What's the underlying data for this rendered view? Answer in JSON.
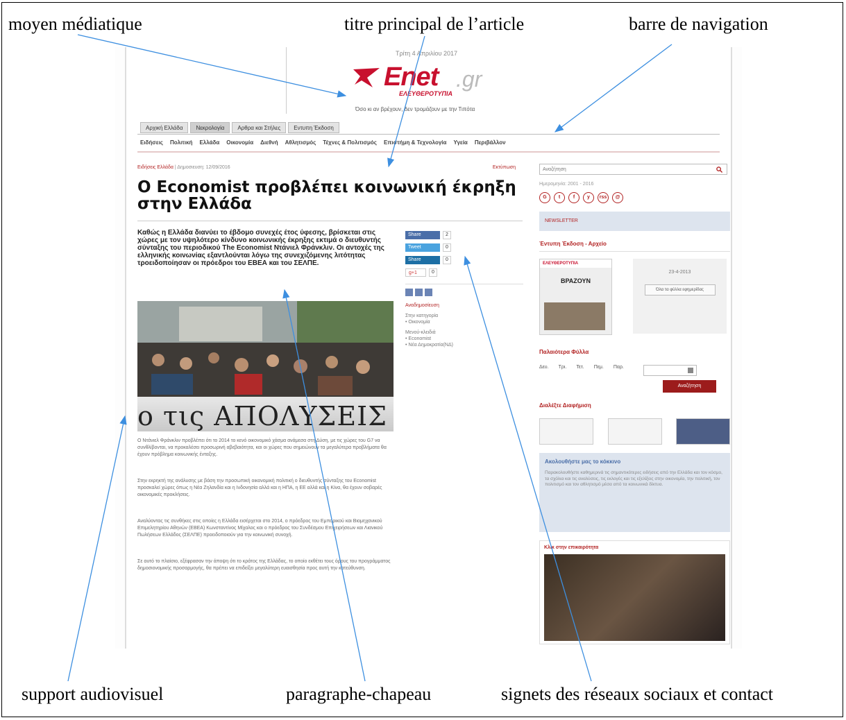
{
  "labels": {
    "media": "moyen médiatique",
    "main_title": "titre principal de l’article",
    "navbar": "barre de navigation",
    "audiovisual": "support audiovisuel",
    "lead": "paragraphe-chapeau",
    "social": "signets des réseaux sociaux et contact"
  },
  "site": {
    "date": "Τρίτη 4 Απριλίου 2017",
    "logo_text": "Enet",
    "logo_suffix": ".gr",
    "logo_sub": "ΕΛΕΥΘΕΡΟΤΥΠΙΑ",
    "slogan": "Όσο κι αν βρέχουν, δεν τρομάζουν με την Τιπότα"
  },
  "nav": {
    "tabs": [
      "Αρχική Ελλάδα",
      "Νεκρολογία",
      "Αρθρα και Στήλες",
      "Εντυπη Έκδοση"
    ],
    "items": [
      "Ειδήσεις",
      "Πολιτική",
      "Ελλάδα",
      "Οικονομία",
      "Διεθνή",
      "Αθλητισμός",
      "Τέχνες & Πολιτισμός",
      "Επιστήμη & Τεχνολογία",
      "Υγεία",
      "Περιβάλλον"
    ]
  },
  "article": {
    "category": "Ειδήσεις Ελλάδα",
    "timestamp": "Δημοσιευση: 12/09/2016",
    "share_label": "Εκτύπωση",
    "title": "Ο Economist προβλέπει κοινωνική έκρηξη στην Ελλάδα",
    "lede": "Καθώς η Ελλάδα διανύει το έβδομο συνεχές έτος ύφεσης, βρίσκεται στις χώρες με τον υψηλότερο κίνδυνο κοινωνικής έκρηξης εκτιμά ο διευθυντής σύνταξης του περιοδικού The Economist Ντάνιελ Φράνκλιν. Οι αντοχές της ελληνικής κοινωνίας εξαντλούνται λόγω της συνεχιζόμενης λιτότητας τροειδοποίησαν οι πρόεδροι του ΕΒΕΑ και του ΣΕΛΠΕ.",
    "photo_banner": "ο τις ΑΠΟΛΥΣΕΙΣ",
    "paragraphs": [
      "Ο Ντάνιελ Φράνκλιν προβλέπει ότι το 2014 το κενό οικονομικό χάσμα ανάμεσα στη Δύση, με τις χώρες του G7 να συνθλίβονται, να προκαλέσει προσωρινή αβεβαιότητα, και οι χώρες που σημειώνουν τα μεγαλύτερα προβλήματα θα έχουν πρόβλημα κοινωνικής ένταξης.",
      "Στην εκρηκτή της ανάλυσης με βάση την προσωπική οικονομική πολιτική ο διευθυντής σύνταξης του Economist προσκαλεί χώρες όπως η Νέα Ζηλανδία και η Ινδονησία αλλά και η ΗΠΑ, η ΕΕ αλλά και η Κίνα, θα έχουν σοβαρές οικονομικές προκλήσεις.",
      "Αναλύοντας τις συνθήκες στις οποίες η Ελλάδα εισέρχεται στο 2014, ο πρόεδρος του Εμπορικού και Βιομηχανικού Επιμελητηρίου Αθηνών (ΕΒΕΑ) Κωνσταντίνος Μίχαλος και ο πρόεδρος του Συνδέσμου Επιχειρήσεων και Λιανικού Πωλήσεων Ελλάδος (ΣΕΛΠΕ) προειδοποιούν για την κοινωνική συνοχή.",
      "Σε αυτό το πλαίσιο, εξέφρασαν την άποψη ότι το κράτος της Ελλάδας, το οποίο εκθέτει τους όρους του προγράμματος δημοσιονομικής προσαρμογής, θα πρέπει να επιδείξει μεγαλύτερη ευαισθησία προς αυτή την κατεύθυνση."
    ]
  },
  "social_col": {
    "buttons": [
      {
        "label": "Share",
        "count": "2"
      },
      {
        "label": "Tweet",
        "count": "0"
      },
      {
        "label": "Share",
        "count": "0"
      },
      {
        "label": "g+1",
        "count": "0"
      }
    ],
    "related_label": "Αναδημοσίευση",
    "related_items": [
      "Στην κατηγορία",
      "• Οικονομία",
      "Μενού-κλειδιά",
      "• Economist",
      "• Νέα Δημοκρατία(ΝΔ)"
    ]
  },
  "sidebar": {
    "search_placeholder": "Αναζήτηση",
    "updated": "Ημερομηνία: 2001 - 2016",
    "socials": [
      "G",
      "t",
      "f",
      "y",
      "rss",
      "@"
    ],
    "newsletter": "NEWSLETTER",
    "paper_title": "Έντυπη Έκδοση - Αρχείο",
    "paper_mast": "ΕΛΕΥΘΕΡΟΤΥΠΙΑ",
    "paper_head": "ΒΡΑΖΟΥΝ",
    "paper_date": "23-4-2013",
    "paper_btn": "Όλα τα φύλλα εφημερίδας",
    "archive_title": "Παλαιότερα Φύλλα",
    "archive_days": [
      "Δευ.",
      "Τρι.",
      "Τετ.",
      "Πεμ.",
      "Παρ."
    ],
    "archive_btn": "Αναζήτηση",
    "ads_title": "Διαλέξτε Διαφήμιση",
    "follow_title": "Ακολουθήστε μας το κόκκινο",
    "follow_text": "Παρακολουθήστε καθημερινά τις σημαντικότερες ειδήσεις από την Ελλάδα και τον κόσμο, τα σχόλια και τις αναλύσεις, τις εκλογές και τις εξελίξεις στην οικονομία, την πολιτική, τον πολιτισμό και τον αθλητισμό μέσα από τα κοινωνικά δίκτυα.",
    "video_title": "Κλικ στην επικαιρότητα"
  },
  "colors": {
    "brand_red": "#c8102e",
    "arrow_blue": "#3d8fe0"
  }
}
